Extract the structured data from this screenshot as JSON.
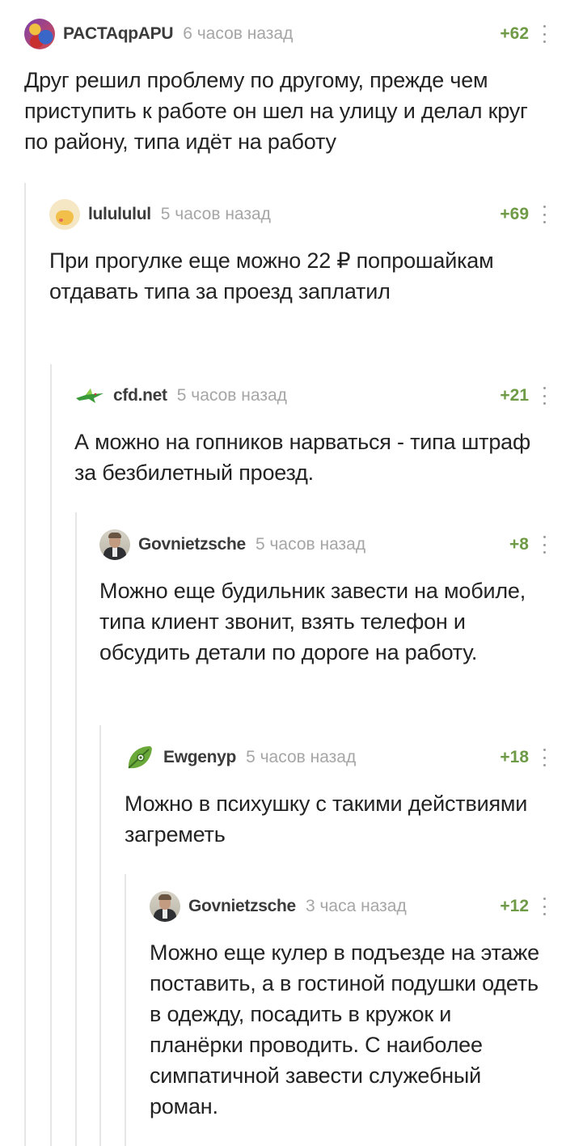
{
  "comments": [
    {
      "author": "PACTAqpAPU",
      "time": "6 часов назад",
      "rating": "+62",
      "text": "Друг решил проблему по другому, прежде чем приступить к работе он шел на улицу и делал круг по району, типа идёт на работу"
    },
    {
      "author": "lulululul",
      "time": "5 часов назад",
      "rating": "+69",
      "text": "При прогулке еще можно 22 ₽ попрошайкам отдавать типа за проезд заплатил"
    },
    {
      "author": "cfd.net",
      "time": "5 часов назад",
      "rating": "+21",
      "text": "А можно на гопников нарваться - типа штраф за безбилетный проезд."
    },
    {
      "author": "Govnietzsche",
      "time": "5 часов назад",
      "rating": "+8",
      "text": "Можно еще будильник завести на мобиле, типа клиент звонит, взять телефон и обсудить детали по дороге на работу."
    },
    {
      "author": "Ewgenyp",
      "time": "5 часов назад",
      "rating": "+18",
      "text": "Можно в психушку с такими действиями загреметь"
    },
    {
      "author": "Govnietzsche",
      "time": "3 часа назад",
      "rating": "+12",
      "text": "Можно еще кулер в подъезде на этаже поставить, а в гостиной подушки одеть в одежду, посадить в кружок и планёрки проводить. С наиболее симпатичной завести служебный роман."
    }
  ],
  "icons": {
    "avatar_1": "abstract-avatar-icon",
    "avatar_2": "emoji-avatar-icon",
    "avatar_3": "bird-avatar-icon",
    "avatar_4": "portrait-avatar-icon",
    "avatar_5": "leaf-avatar-icon",
    "more": "more-vertical-icon"
  },
  "colors": {
    "rating": "#6f9a46",
    "time": "#a6a6a6",
    "branch": "#e6e6e6"
  }
}
